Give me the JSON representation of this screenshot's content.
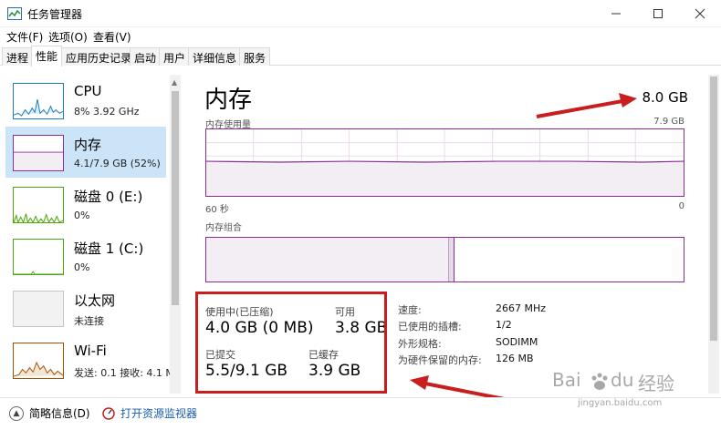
{
  "window": {
    "title": "任务管理器",
    "controls": [
      "minimize",
      "maximize",
      "close"
    ]
  },
  "menu": {
    "items": [
      {
        "label": "文件(F)"
      },
      {
        "label": "选项(O)"
      },
      {
        "label": "查看(V)"
      }
    ]
  },
  "tabs": {
    "items": [
      {
        "label": "进程"
      },
      {
        "label": "性能"
      },
      {
        "label": "应用历史记录"
      },
      {
        "label": "启动"
      },
      {
        "label": "用户"
      },
      {
        "label": "详细信息"
      },
      {
        "label": "服务"
      }
    ],
    "active": "性能"
  },
  "sidebar": {
    "items": [
      {
        "title": "CPU",
        "subtitle": "8% 3.92 GHz",
        "color": "#1b7dbb"
      },
      {
        "title": "内存",
        "subtitle": "4.1/7.9 GB (52%)",
        "color": "#8b2b95",
        "selected": true
      },
      {
        "title": "磁盘 0 (E:)",
        "subtitle": "0%",
        "color": "#4da60c"
      },
      {
        "title": "磁盘 1 (C:)",
        "subtitle": "0%",
        "color": "#4da60c"
      },
      {
        "title": "以太网",
        "subtitle": "未连接",
        "color": "#c6c6c6"
      },
      {
        "title": "Wi-Fi",
        "subtitle": "发送: 0.1  接收: 4.1 M",
        "color": "#a74f01"
      }
    ]
  },
  "main": {
    "heading": "内存",
    "total": "8.0 GB",
    "usage_graph_label": "内存使用量",
    "usage_graph_max": "7.9 GB",
    "usage_axis_left": "60 秒",
    "usage_axis_right": "0",
    "composition_label": "内存组合",
    "stats": {
      "in_use_label": "使用中(已压缩)",
      "in_use_value": "4.0 GB (0 MB)",
      "available_label": "可用",
      "available_value": "3.8 GB",
      "committed_label": "已提交",
      "committed_value": "5.5/9.1 GB",
      "cached_label": "已缓存",
      "cached_value": "3.9 GB"
    },
    "details": [
      {
        "label": "速度:",
        "value": "2667 MHz"
      },
      {
        "label": "已使用的插槽:",
        "value": "1/2"
      },
      {
        "label": "外形规格:",
        "value": "SODIMM"
      },
      {
        "label": "为硬件保留的内存:",
        "value": "126 MB"
      }
    ]
  },
  "footer": {
    "summary_label": "简略信息(D)",
    "resource_monitor_label": "打开资源监视器"
  },
  "watermark": {
    "logo_text": "Bai",
    "logo_text2": "du",
    "brand_cn": "经验",
    "domain": "jingyan.baidu.com"
  },
  "accent_colors": {
    "memory": "#8b2b95",
    "annotation": "#c81e1e"
  }
}
